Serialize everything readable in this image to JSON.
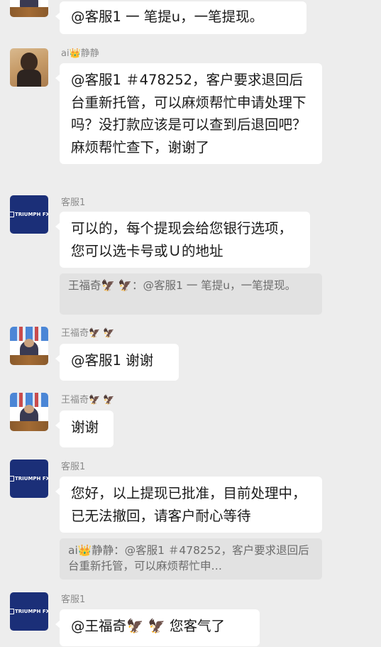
{
  "messages": [
    {
      "text": "@客服1 一 笔提u，一笔提现。"
    },
    {
      "sender": "ai👑静静",
      "text": "@客服1 ＃478252，客户要求退回后台重新托管，可以麻烦帮忙申请处理下吗？没打款应该是可以查到后退回吧？麻烦帮忙查下，谢谢了"
    },
    {
      "sender": "客服1",
      "text": "可以的，每个提现会给您银行选项，您可以选卡号或Ｕ的地址",
      "quote": "王福奇🦅 🦅：@客服1 一 笔提u，一笔提现。"
    },
    {
      "sender": "王福奇🦅 🦅",
      "text": "@客服1 谢谢"
    },
    {
      "sender": "王福奇🦅 🦅",
      "text": "谢谢"
    },
    {
      "sender": "客服1",
      "text": "您好，以上提现已批准，目前处理中，已无法撤回，请客户耐心等待",
      "quote": "ai👑静静：@客服1 ＃478252，客户要求退回后台重新托管，可以麻烦帮忙申…"
    },
    {
      "sender": "客服1",
      "text": "@王福奇🦅 🦅 您客气了"
    }
  ],
  "logo_text": "TRIUMPH FX"
}
